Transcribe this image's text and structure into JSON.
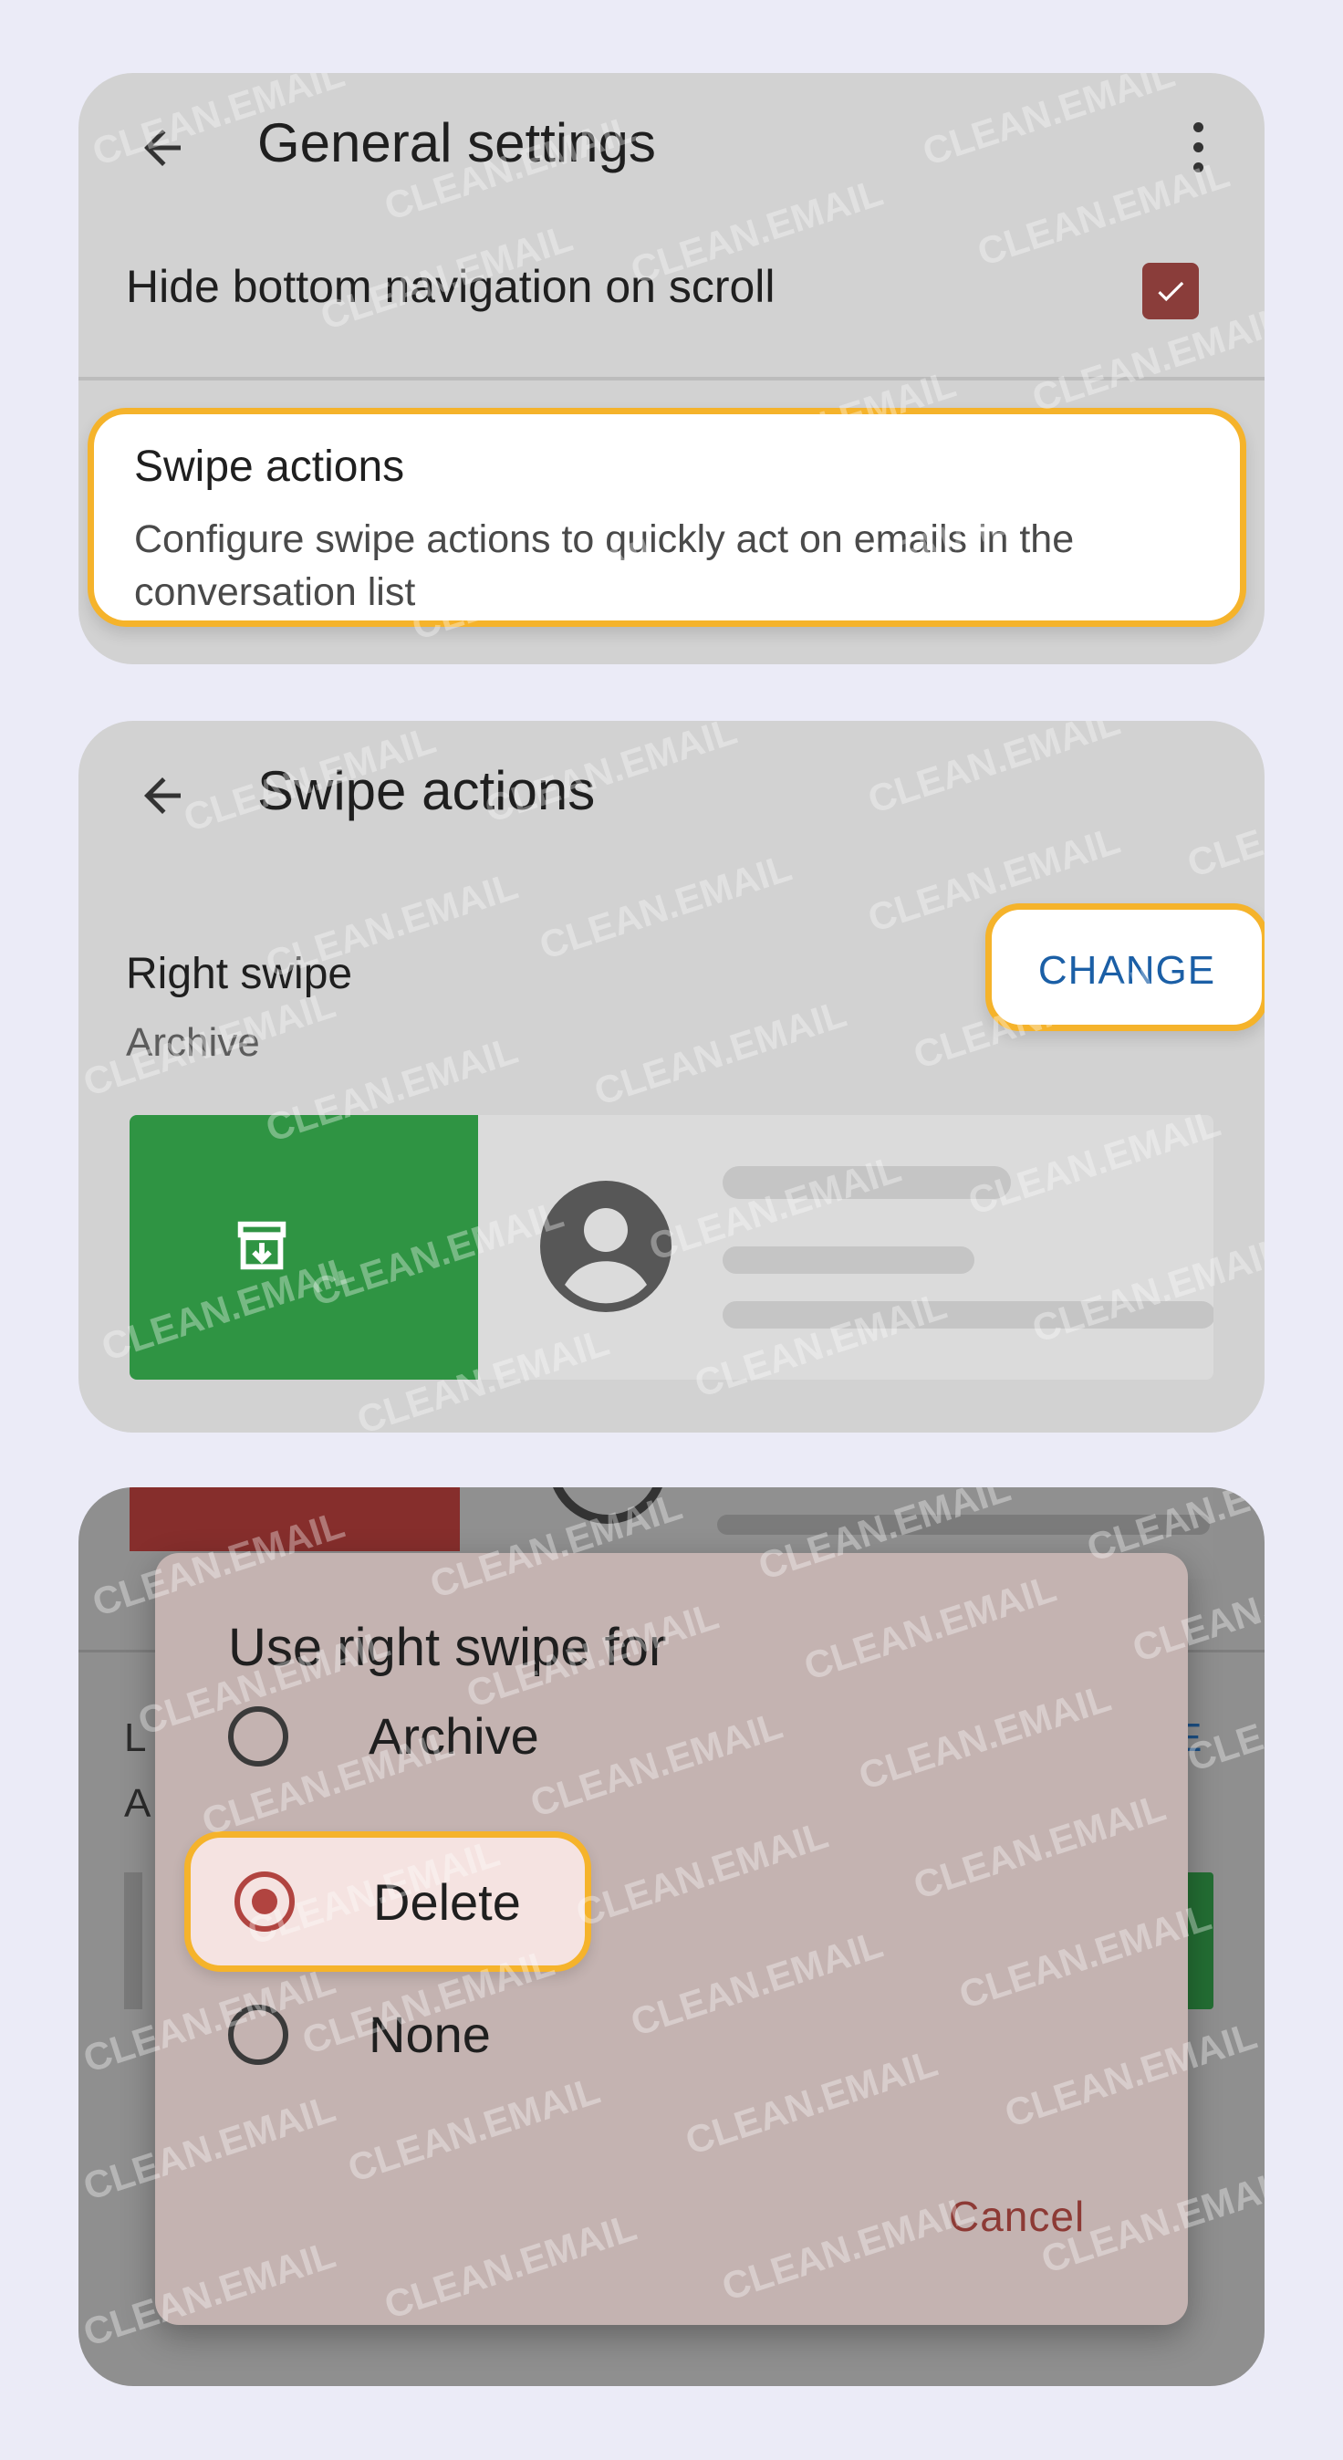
{
  "panel1": {
    "title": "General settings",
    "hide_nav_label": "Hide bottom navigation on scroll",
    "hide_nav_checked": true,
    "swipe_title": "Swipe actions",
    "swipe_description": "Configure swipe actions to quickly act on emails in the conversation list"
  },
  "panel2": {
    "title": "Swipe actions",
    "right_swipe_label": "Right swipe",
    "right_swipe_value": "Archive",
    "change_label": "CHANGE"
  },
  "panel3": {
    "behind_letter_l": "L",
    "behind_letter_a": "A",
    "behind_letters_e": "E",
    "dialog": {
      "title": "Use right swipe for",
      "options": [
        "Archive",
        "Delete",
        "None"
      ],
      "selected": "Delete",
      "cancel_label": "Cancel"
    }
  },
  "watermark": "CLEAN.EMAIL",
  "colors": {
    "highlight": "#f5b32b",
    "checkbox": "#8a3d3a",
    "archive_green": "#2f9443",
    "accent_blue": "#1b5fa6",
    "radio_selected": "#b14440"
  },
  "icons": [
    "back-arrow-icon",
    "more-vert-icon",
    "check-icon",
    "archive-icon",
    "account-circle-icon"
  ]
}
